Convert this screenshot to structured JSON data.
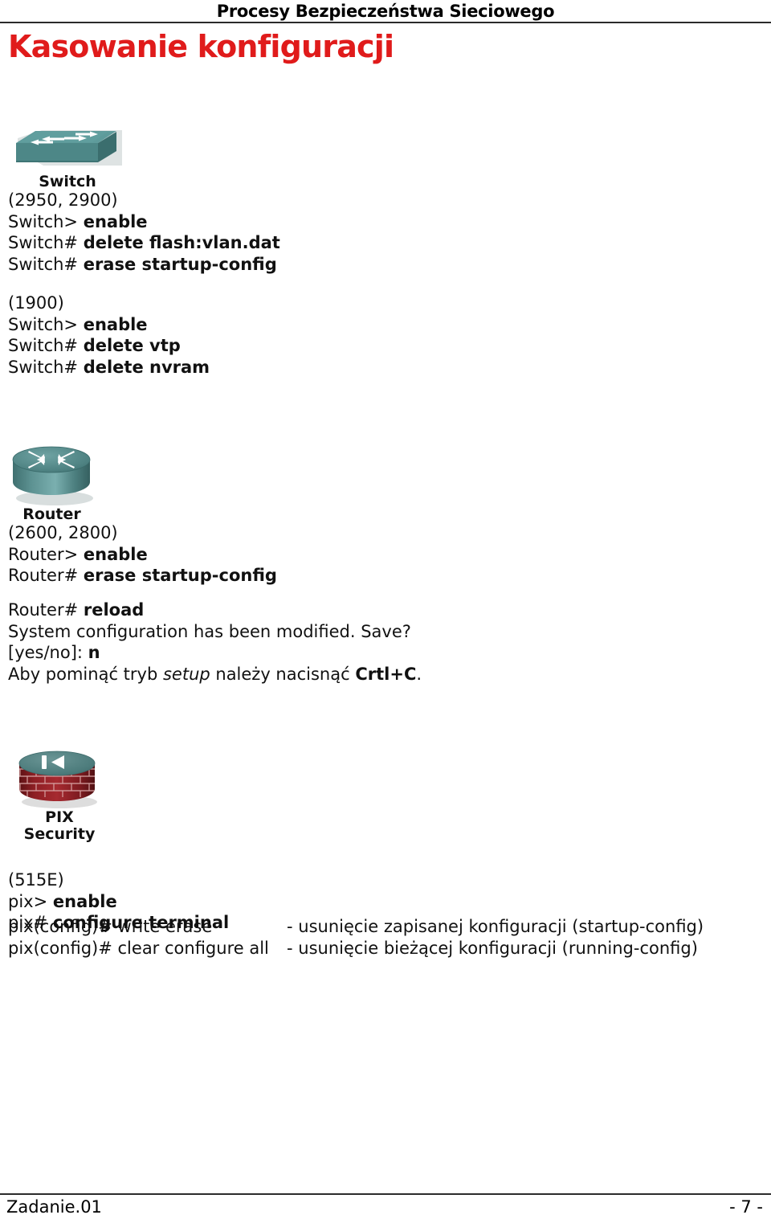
{
  "document": {
    "header_title": "Procesy Bezpieczeństwa Sieciowego",
    "page_title": "Kasowanie konfiguracji",
    "title_color": "#e01b1b"
  },
  "switch_section": {
    "icon_name": "switch-icon",
    "icon_caption": "Switch",
    "icon_colors": {
      "top": "#5e9b9b",
      "front": "#4d8787",
      "side": "#3d7272",
      "arrow": "#ffffff",
      "shadow": "#b9c3c3"
    },
    "block_2950": {
      "model": "(2950, 2900)",
      "lines": [
        {
          "prompt": "Switch> ",
          "command": "enable"
        },
        {
          "prompt": "Switch# ",
          "command": "delete flash:vlan.dat"
        },
        {
          "prompt": "Switch# ",
          "command": "erase startup-config"
        }
      ]
    },
    "block_1900": {
      "model": "(1900)",
      "lines": [
        {
          "prompt": "Switch> ",
          "command": "enable"
        },
        {
          "prompt": "Switch# ",
          "command": "delete vtp"
        },
        {
          "prompt": "Switch# ",
          "command": "delete nvram"
        }
      ]
    }
  },
  "router_section": {
    "icon_name": "router-icon",
    "icon_caption": "Router",
    "icon_colors": {
      "top": "#5e9292",
      "body": "#4e8383",
      "arrow": "#ffffff",
      "shadow": "#bcc6c6"
    },
    "model": "(2600, 2800)",
    "lines": [
      {
        "prompt": "Router> ",
        "command": "enable"
      },
      {
        "prompt": "Router# ",
        "command": "erase startup-config"
      }
    ],
    "reload": {
      "prompt": "Router# ",
      "command": "reload",
      "output": "System configuration has been modified. Save?",
      "answer_prompt": "[yes/no]: ",
      "answer": "n",
      "note_pre": "Aby pominąć tryb ",
      "note_italic": "setup",
      "note_mid": " należy nacisnąć ",
      "note_bold": "Crtl+C",
      "note_post": "."
    }
  },
  "pix_section": {
    "icon_name": "pix-security-icon",
    "icon_caption_line1": "PIX",
    "icon_caption_line2": "Security",
    "icon_colors": {
      "top": "#4e7d7d",
      "brick": "#8e1f24",
      "brick_dark": "#6e1418",
      "mortar": "#c98f90",
      "arrow": "#ffffff",
      "shadow": "#c4c4c4"
    },
    "model": "(515E)",
    "lines": [
      {
        "prompt": "pix> ",
        "command": "enable"
      },
      {
        "prompt": "pix# ",
        "command": "configure terminal"
      }
    ],
    "rows": [
      {
        "prompt": "pix(config)# ",
        "command": "write erase",
        "description": "- usunięcie zapisanej konfiguracji (startup-config)"
      },
      {
        "prompt": "pix(config)# ",
        "command": "clear configure all",
        "description": "- usunięcie bieżącej konfiguracji (running-config)"
      }
    ]
  },
  "footer": {
    "left": "Zadanie.01",
    "right": "- 7 -"
  }
}
